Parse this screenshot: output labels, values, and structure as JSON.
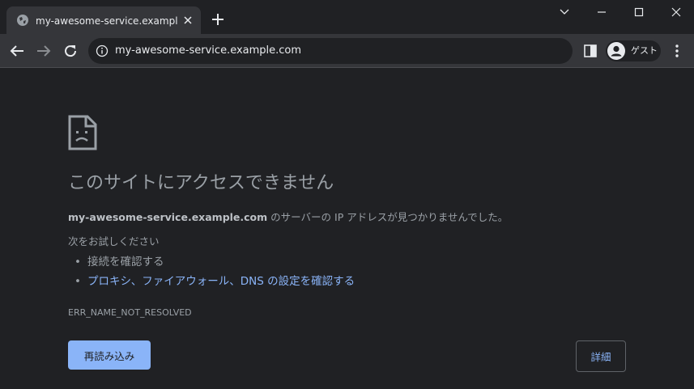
{
  "tab": {
    "title": "my-awesome-service.example.com",
    "favicon": "globe-icon"
  },
  "window_controls": [
    "chevron-down-icon",
    "minimize-icon",
    "maximize-icon",
    "close-icon"
  ],
  "toolbar": {
    "url": "my-awesome-service.example.com",
    "profile_label": "ゲスト"
  },
  "error": {
    "heading": "このサイトにアクセスできません",
    "host": "my-awesome-service.example.com",
    "message": " のサーバーの IP アドレスが見つかりませんでした。",
    "try_label": "次をお試しください",
    "suggestions": [
      "接続を確認する",
      "プロキシ、ファイアウォール、DNS の設定を確認する"
    ],
    "code": "ERR_NAME_NOT_RESOLVED"
  },
  "buttons": {
    "reload": "再読み込み",
    "details": "詳細"
  },
  "colors": {
    "background": "#202124",
    "toolbar": "#35363a",
    "accent": "#8ab4f8",
    "text": "#9aa0a6"
  }
}
